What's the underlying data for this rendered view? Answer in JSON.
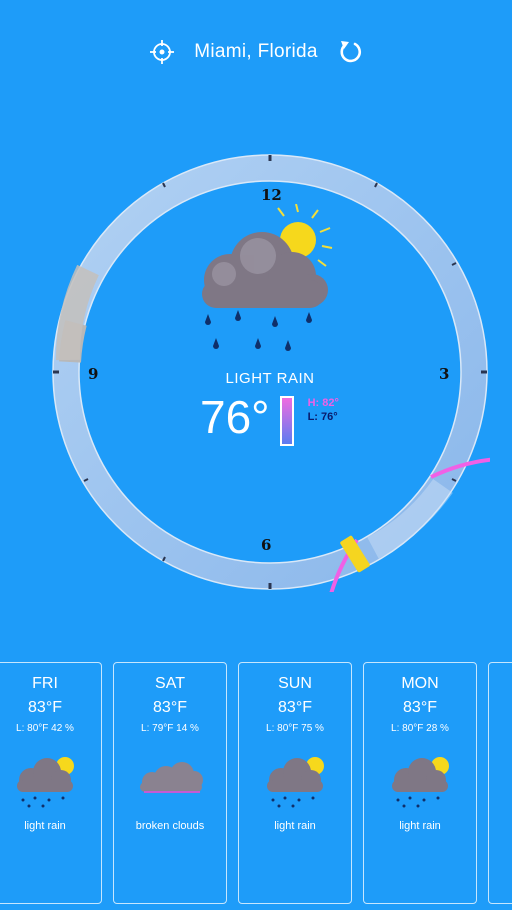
{
  "header": {
    "location": "Miami, Florida",
    "locate_icon": "crosshair-icon",
    "refresh_icon": "refresh-icon"
  },
  "current": {
    "condition": "LIGHT RAIN",
    "temperature": "76°",
    "high": "H: 82°",
    "low": "L: 76°",
    "icon": "rain-cloud-sun-icon"
  },
  "dial": {
    "numbers": {
      "twelve": "12",
      "three": "3",
      "six": "6",
      "nine": "9"
    }
  },
  "forecast": [
    {
      "day": "FRI",
      "temp": "83°F",
      "low_precip": "L: 80°F 42 %",
      "description": "light rain",
      "icon": "rain-cloud-sun-icon"
    },
    {
      "day": "SAT",
      "temp": "83°F",
      "low_precip": "L: 79°F 14 %",
      "description": "broken clouds",
      "icon": "cloud-icon"
    },
    {
      "day": "SUN",
      "temp": "83°F",
      "low_precip": "L: 80°F 75 %",
      "description": "light rain",
      "icon": "rain-cloud-sun-icon"
    },
    {
      "day": "MON",
      "temp": "83°F",
      "low_precip": "L: 80°F 28 %",
      "description": "light rain",
      "icon": "rain-cloud-sun-icon"
    }
  ],
  "colors": {
    "background": "#1e9cf9",
    "ring_accent": "#f060e6",
    "now_marker": "#f5d520"
  }
}
